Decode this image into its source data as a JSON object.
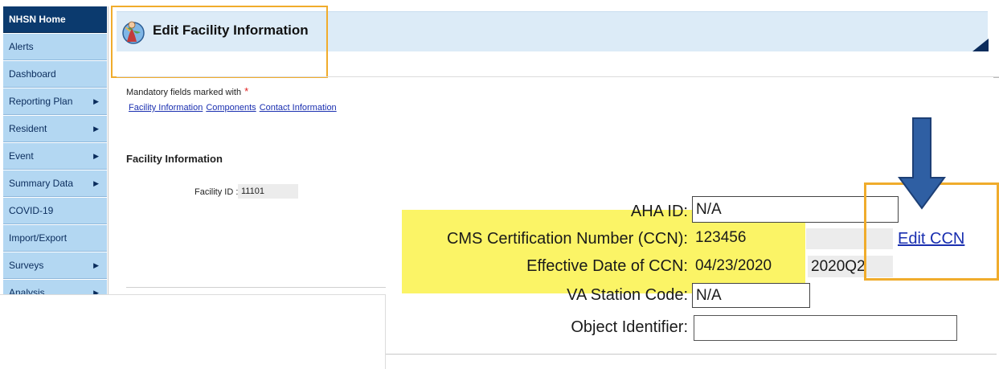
{
  "sidebar": {
    "items": [
      {
        "label": "NHSN Home",
        "has_submenu": false,
        "active": true
      },
      {
        "label": "Alerts",
        "has_submenu": false
      },
      {
        "label": "Dashboard",
        "has_submenu": false
      },
      {
        "label": "Reporting Plan",
        "has_submenu": true
      },
      {
        "label": "Resident",
        "has_submenu": true
      },
      {
        "label": "Event",
        "has_submenu": true
      },
      {
        "label": "Summary Data",
        "has_submenu": true
      },
      {
        "label": "COVID-19",
        "has_submenu": false
      },
      {
        "label": "Import/Export",
        "has_submenu": false
      },
      {
        "label": "Surveys",
        "has_submenu": true
      },
      {
        "label": "Analysis",
        "has_submenu": true
      }
    ],
    "arrow_glyph": "▶"
  },
  "header": {
    "title": "Edit Facility Information",
    "icon": "globe-person-icon"
  },
  "mandatory_note": "Mandatory fields marked with",
  "mandatory_star": "*",
  "nav_links": {
    "facility_information": "Facility Information",
    "components": "Components",
    "contact_information": "Contact Information"
  },
  "section_title": "Facility Information",
  "facility_id": {
    "label": "Facility ID :",
    "value": "11101"
  },
  "form": {
    "aha_id": {
      "label": "AHA ID:",
      "value": "N/A"
    },
    "ccn": {
      "label": "CMS Certification Number (CCN):",
      "value": "123456"
    },
    "effective_date": {
      "label": "Effective Date of CCN:",
      "value": "04/23/2020",
      "quarter": "2020Q2"
    },
    "va_station_code": {
      "label": "VA Station Code:",
      "value": "N/A"
    },
    "object_identifier": {
      "label": "Object Identifier:",
      "value": ""
    },
    "edit_ccn_link": "Edit CCN"
  },
  "colors": {
    "sidebar_bg": "#b3d7f2",
    "sidebar_active": "#0b3a6e",
    "highlight_yellow": "#fbf466",
    "callout_orange": "#f0ac2c",
    "arrow_blue": "#2f5fa3",
    "link_blue": "#1a2fb0"
  }
}
